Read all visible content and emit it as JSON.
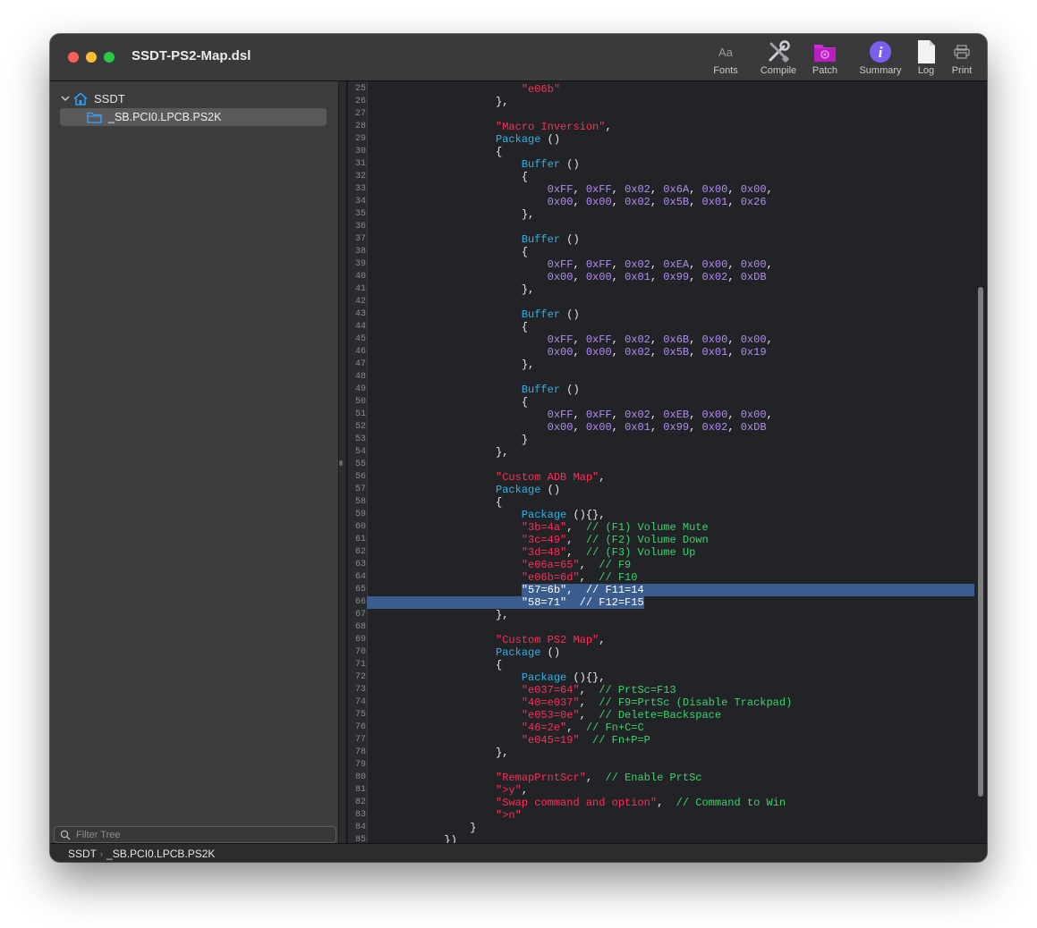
{
  "window": {
    "title": "SSDT-PS2-Map.dsl"
  },
  "toolbar": {
    "fonts_label": "Fonts",
    "fonts_glyph": "Aa",
    "compile_label": "Compile",
    "patch_label": "Patch",
    "summary_label": "Summary",
    "log_label": "Log",
    "print_label": "Print"
  },
  "sidebar": {
    "root_label": "SSDT",
    "items": [
      {
        "label": "_SB.PCI0.LPCB.PS2K"
      }
    ],
    "filter_placeholder": "Filter Tree"
  },
  "status": {
    "root": "SSDT",
    "path": "_SB.PCI0.LPCB.PS2K"
  },
  "colors": {
    "string": "#ff2d55",
    "keyword": "#2db4e6",
    "number": "#b38cf0",
    "comment": "#3ad36a",
    "selection": "#3a5c8e"
  },
  "editor": {
    "lines": [
      {
        "num": "25",
        "segs": [
          [
            "                        ",
            ""
          ],
          [
            "\"e06b\"",
            "s"
          ]
        ]
      },
      {
        "num": "26",
        "segs": [
          [
            "                    },",
            ""
          ]
        ]
      },
      {
        "num": "27",
        "segs": [
          [
            "",
            ""
          ]
        ]
      },
      {
        "num": "28",
        "segs": [
          [
            "                    ",
            ""
          ],
          [
            "\"Macro Inversion\"",
            "s"
          ],
          [
            ",",
            ""
          ]
        ]
      },
      {
        "num": "29",
        "segs": [
          [
            "                    ",
            ""
          ],
          [
            "Package",
            "k"
          ],
          [
            " ()",
            ""
          ]
        ]
      },
      {
        "num": "30",
        "segs": [
          [
            "                    {",
            ""
          ]
        ]
      },
      {
        "num": "31",
        "segs": [
          [
            "                        ",
            ""
          ],
          [
            "Buffer",
            "k"
          ],
          [
            " ()",
            ""
          ]
        ]
      },
      {
        "num": "32",
        "segs": [
          [
            "                        {",
            ""
          ]
        ]
      },
      {
        "num": "33",
        "segs": [
          [
            "                            ",
            ""
          ],
          [
            "0xFF",
            "n"
          ],
          [
            ", ",
            ""
          ],
          [
            "0xFF",
            "n"
          ],
          [
            ", ",
            ""
          ],
          [
            "0x02",
            "n"
          ],
          [
            ", ",
            ""
          ],
          [
            "0x6A",
            "n"
          ],
          [
            ", ",
            ""
          ],
          [
            "0x00",
            "n"
          ],
          [
            ", ",
            ""
          ],
          [
            "0x00",
            "n"
          ],
          [
            ",",
            ""
          ]
        ]
      },
      {
        "num": "34",
        "segs": [
          [
            "                            ",
            ""
          ],
          [
            "0x00",
            "n"
          ],
          [
            ", ",
            ""
          ],
          [
            "0x00",
            "n"
          ],
          [
            ", ",
            ""
          ],
          [
            "0x02",
            "n"
          ],
          [
            ", ",
            ""
          ],
          [
            "0x5B",
            "n"
          ],
          [
            ", ",
            ""
          ],
          [
            "0x01",
            "n"
          ],
          [
            ", ",
            ""
          ],
          [
            "0x26",
            "n"
          ]
        ]
      },
      {
        "num": "35",
        "segs": [
          [
            "                        },",
            ""
          ]
        ]
      },
      {
        "num": "36",
        "segs": [
          [
            "",
            ""
          ]
        ]
      },
      {
        "num": "37",
        "segs": [
          [
            "                        ",
            ""
          ],
          [
            "Buffer",
            "k"
          ],
          [
            " ()",
            ""
          ]
        ]
      },
      {
        "num": "38",
        "segs": [
          [
            "                        {",
            ""
          ]
        ]
      },
      {
        "num": "39",
        "segs": [
          [
            "                            ",
            ""
          ],
          [
            "0xFF",
            "n"
          ],
          [
            ", ",
            ""
          ],
          [
            "0xFF",
            "n"
          ],
          [
            ", ",
            ""
          ],
          [
            "0x02",
            "n"
          ],
          [
            ", ",
            ""
          ],
          [
            "0xEA",
            "n"
          ],
          [
            ", ",
            ""
          ],
          [
            "0x00",
            "n"
          ],
          [
            ", ",
            ""
          ],
          [
            "0x00",
            "n"
          ],
          [
            ",",
            ""
          ]
        ]
      },
      {
        "num": "40",
        "segs": [
          [
            "                            ",
            ""
          ],
          [
            "0x00",
            "n"
          ],
          [
            ", ",
            ""
          ],
          [
            "0x00",
            "n"
          ],
          [
            ", ",
            ""
          ],
          [
            "0x01",
            "n"
          ],
          [
            ", ",
            ""
          ],
          [
            "0x99",
            "n"
          ],
          [
            ", ",
            ""
          ],
          [
            "0x02",
            "n"
          ],
          [
            ", ",
            ""
          ],
          [
            "0xDB",
            "n"
          ]
        ]
      },
      {
        "num": "41",
        "segs": [
          [
            "                        },",
            ""
          ]
        ]
      },
      {
        "num": "42",
        "segs": [
          [
            "",
            ""
          ]
        ]
      },
      {
        "num": "43",
        "segs": [
          [
            "                        ",
            ""
          ],
          [
            "Buffer",
            "k"
          ],
          [
            " ()",
            ""
          ]
        ]
      },
      {
        "num": "44",
        "segs": [
          [
            "                        {",
            ""
          ]
        ]
      },
      {
        "num": "45",
        "segs": [
          [
            "                            ",
            ""
          ],
          [
            "0xFF",
            "n"
          ],
          [
            ", ",
            ""
          ],
          [
            "0xFF",
            "n"
          ],
          [
            ", ",
            ""
          ],
          [
            "0x02",
            "n"
          ],
          [
            ", ",
            ""
          ],
          [
            "0x6B",
            "n"
          ],
          [
            ", ",
            ""
          ],
          [
            "0x00",
            "n"
          ],
          [
            ", ",
            ""
          ],
          [
            "0x00",
            "n"
          ],
          [
            ",",
            ""
          ]
        ]
      },
      {
        "num": "46",
        "segs": [
          [
            "                            ",
            ""
          ],
          [
            "0x00",
            "n"
          ],
          [
            ", ",
            ""
          ],
          [
            "0x00",
            "n"
          ],
          [
            ", ",
            ""
          ],
          [
            "0x02",
            "n"
          ],
          [
            ", ",
            ""
          ],
          [
            "0x5B",
            "n"
          ],
          [
            ", ",
            ""
          ],
          [
            "0x01",
            "n"
          ],
          [
            ", ",
            ""
          ],
          [
            "0x19",
            "n"
          ]
        ]
      },
      {
        "num": "47",
        "segs": [
          [
            "                        },",
            ""
          ]
        ]
      },
      {
        "num": "48",
        "segs": [
          [
            "",
            ""
          ]
        ]
      },
      {
        "num": "49",
        "segs": [
          [
            "                        ",
            ""
          ],
          [
            "Buffer",
            "k"
          ],
          [
            " ()",
            ""
          ]
        ]
      },
      {
        "num": "50",
        "segs": [
          [
            "                        {",
            ""
          ]
        ]
      },
      {
        "num": "51",
        "segs": [
          [
            "                            ",
            ""
          ],
          [
            "0xFF",
            "n"
          ],
          [
            ", ",
            ""
          ],
          [
            "0xFF",
            "n"
          ],
          [
            ", ",
            ""
          ],
          [
            "0x02",
            "n"
          ],
          [
            ", ",
            ""
          ],
          [
            "0xEB",
            "n"
          ],
          [
            ", ",
            ""
          ],
          [
            "0x00",
            "n"
          ],
          [
            ", ",
            ""
          ],
          [
            "0x00",
            "n"
          ],
          [
            ",",
            ""
          ]
        ]
      },
      {
        "num": "52",
        "segs": [
          [
            "                            ",
            ""
          ],
          [
            "0x00",
            "n"
          ],
          [
            ", ",
            ""
          ],
          [
            "0x00",
            "n"
          ],
          [
            ", ",
            ""
          ],
          [
            "0x01",
            "n"
          ],
          [
            ", ",
            ""
          ],
          [
            "0x99",
            "n"
          ],
          [
            ", ",
            ""
          ],
          [
            "0x02",
            "n"
          ],
          [
            ", ",
            ""
          ],
          [
            "0xDB",
            "n"
          ]
        ]
      },
      {
        "num": "53",
        "segs": [
          [
            "                        }",
            ""
          ]
        ]
      },
      {
        "num": "54",
        "segs": [
          [
            "                    },",
            ""
          ]
        ]
      },
      {
        "num": "55",
        "segs": [
          [
            "",
            ""
          ]
        ]
      },
      {
        "num": "56",
        "segs": [
          [
            "                    ",
            ""
          ],
          [
            "\"Custom ADB Map\"",
            "s"
          ],
          [
            ",",
            ""
          ]
        ]
      },
      {
        "num": "57",
        "segs": [
          [
            "                    ",
            ""
          ],
          [
            "Package",
            "k"
          ],
          [
            " ()",
            ""
          ]
        ]
      },
      {
        "num": "58",
        "segs": [
          [
            "                    {",
            ""
          ]
        ]
      },
      {
        "num": "59",
        "segs": [
          [
            "                        ",
            ""
          ],
          [
            "Package",
            "k"
          ],
          [
            " (){},",
            ""
          ]
        ]
      },
      {
        "num": "60",
        "segs": [
          [
            "                        ",
            ""
          ],
          [
            "\"3b=4a\"",
            "s"
          ],
          [
            ",  ",
            ""
          ],
          [
            "// (F1) Volume Mute",
            "c"
          ]
        ]
      },
      {
        "num": "61",
        "segs": [
          [
            "                        ",
            ""
          ],
          [
            "\"3c=49\"",
            "s"
          ],
          [
            ",  ",
            ""
          ],
          [
            "// (F2) Volume Down",
            "c"
          ]
        ]
      },
      {
        "num": "62",
        "segs": [
          [
            "                        ",
            ""
          ],
          [
            "\"3d=48\"",
            "s"
          ],
          [
            ",  ",
            ""
          ],
          [
            "// (F3) Volume Up",
            "c"
          ]
        ]
      },
      {
        "num": "63",
        "segs": [
          [
            "                        ",
            ""
          ],
          [
            "\"e06a=65\"",
            "s"
          ],
          [
            ",  ",
            ""
          ],
          [
            "// F9",
            "c"
          ]
        ]
      },
      {
        "num": "64",
        "segs": [
          [
            "                        ",
            ""
          ],
          [
            "\"e06b=6d\"",
            "s"
          ],
          [
            ",  ",
            ""
          ],
          [
            "// F10",
            "c"
          ]
        ]
      },
      {
        "num": "65",
        "segs": [
          [
            "                        ",
            ""
          ],
          [
            "\"57=6b\",  // F11=14",
            ""
          ]
        ]
      },
      {
        "num": "66",
        "segs": [
          [
            "                        ",
            ""
          ],
          [
            "\"58=71\"  // F12=F15",
            ""
          ]
        ]
      },
      {
        "num": "67",
        "segs": [
          [
            "                    },",
            ""
          ]
        ]
      },
      {
        "num": "68",
        "segs": [
          [
            "",
            ""
          ]
        ]
      },
      {
        "num": "69",
        "segs": [
          [
            "                    ",
            ""
          ],
          [
            "\"Custom PS2 Map\"",
            "s"
          ],
          [
            ",",
            ""
          ]
        ]
      },
      {
        "num": "70",
        "segs": [
          [
            "                    ",
            ""
          ],
          [
            "Package",
            "k"
          ],
          [
            " ()",
            ""
          ]
        ]
      },
      {
        "num": "71",
        "segs": [
          [
            "                    {",
            ""
          ]
        ]
      },
      {
        "num": "72",
        "segs": [
          [
            "                        ",
            ""
          ],
          [
            "Package",
            "k"
          ],
          [
            " (){},",
            ""
          ]
        ]
      },
      {
        "num": "73",
        "segs": [
          [
            "                        ",
            ""
          ],
          [
            "\"e037=64\"",
            "s"
          ],
          [
            ",  ",
            ""
          ],
          [
            "// PrtSc=F13",
            "c"
          ]
        ]
      },
      {
        "num": "74",
        "segs": [
          [
            "                        ",
            ""
          ],
          [
            "\"40=e037\"",
            "s"
          ],
          [
            ",  ",
            ""
          ],
          [
            "// F9=PrtSc (Disable Trackpad)",
            "c"
          ]
        ]
      },
      {
        "num": "75",
        "segs": [
          [
            "                        ",
            ""
          ],
          [
            "\"e053=0e\"",
            "s"
          ],
          [
            ",  ",
            ""
          ],
          [
            "// Delete=Backspace",
            "c"
          ]
        ]
      },
      {
        "num": "76",
        "segs": [
          [
            "                        ",
            ""
          ],
          [
            "\"46=2e\"",
            "s"
          ],
          [
            ",  ",
            ""
          ],
          [
            "// Fn+C=C",
            "c"
          ]
        ]
      },
      {
        "num": "77",
        "segs": [
          [
            "                        ",
            ""
          ],
          [
            "\"e045=19\"",
            "s"
          ],
          [
            "  ",
            ""
          ],
          [
            "// Fn+P=P",
            "c"
          ]
        ]
      },
      {
        "num": "78",
        "segs": [
          [
            "                    },",
            ""
          ]
        ]
      },
      {
        "num": "79",
        "segs": [
          [
            "",
            ""
          ]
        ]
      },
      {
        "num": "80",
        "segs": [
          [
            "                    ",
            ""
          ],
          [
            "\"RemapPrntScr\"",
            "s"
          ],
          [
            ",  ",
            ""
          ],
          [
            "// Enable PrtSc",
            "c"
          ]
        ]
      },
      {
        "num": "81",
        "segs": [
          [
            "                    ",
            ""
          ],
          [
            "\">y\"",
            "s"
          ],
          [
            ",",
            ""
          ]
        ]
      },
      {
        "num": "82",
        "segs": [
          [
            "                    ",
            ""
          ],
          [
            "\"Swap command and option\"",
            "s"
          ],
          [
            ",  ",
            ""
          ],
          [
            "// Command to Win",
            "c"
          ]
        ]
      },
      {
        "num": "83",
        "segs": [
          [
            "                    ",
            ""
          ],
          [
            "\">n\"",
            "s"
          ]
        ]
      },
      {
        "num": "84",
        "segs": [
          [
            "                }",
            ""
          ]
        ]
      },
      {
        "num": "85",
        "segs": [
          [
            "            })",
            ""
          ]
        ]
      }
    ]
  }
}
